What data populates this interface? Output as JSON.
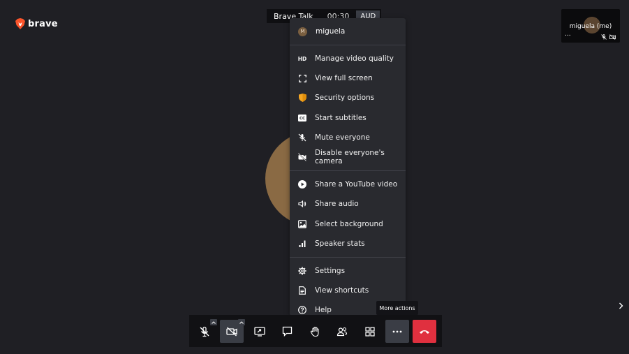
{
  "app": {
    "logo_text": "brave",
    "room_name": "Brave Talk",
    "timer": "00:30",
    "audio_badge": "AUD"
  },
  "participant": {
    "thumbnail_name": "miguela (me)",
    "thumbnail_menu": "..."
  },
  "menu": {
    "user": {
      "initial": "M",
      "name": "miguela"
    },
    "group1": [
      {
        "label": "Manage video quality",
        "icon": "hd-icon"
      },
      {
        "label": "View full screen",
        "icon": "fullscreen-icon"
      },
      {
        "label": "Security options",
        "icon": "shield-icon"
      },
      {
        "label": "Start subtitles",
        "icon": "cc-icon"
      },
      {
        "label": "Mute everyone",
        "icon": "mute-all-icon"
      },
      {
        "label": "Disable everyone's camera",
        "icon": "camera-off-all-icon"
      }
    ],
    "group2": [
      {
        "label": "Share a YouTube video",
        "icon": "play-icon"
      },
      {
        "label": "Share audio",
        "icon": "speaker-icon"
      },
      {
        "label": "Select background",
        "icon": "image-icon"
      },
      {
        "label": "Speaker stats",
        "icon": "bar-chart-icon"
      }
    ],
    "group3": [
      {
        "label": "Settings",
        "icon": "gear-icon"
      },
      {
        "label": "View shortcuts",
        "icon": "document-icon"
      },
      {
        "label": "Help",
        "icon": "help-icon"
      }
    ]
  },
  "tooltip": {
    "text": "More actions"
  },
  "colors": {
    "background": "#1f1f24",
    "menu_bg": "#292a2f",
    "toolbar_bg": "#111114",
    "active_btn": "#3a3d45",
    "hangup": "#e0303f",
    "shield": "#f5a623",
    "avatar": "#8a6a44"
  }
}
